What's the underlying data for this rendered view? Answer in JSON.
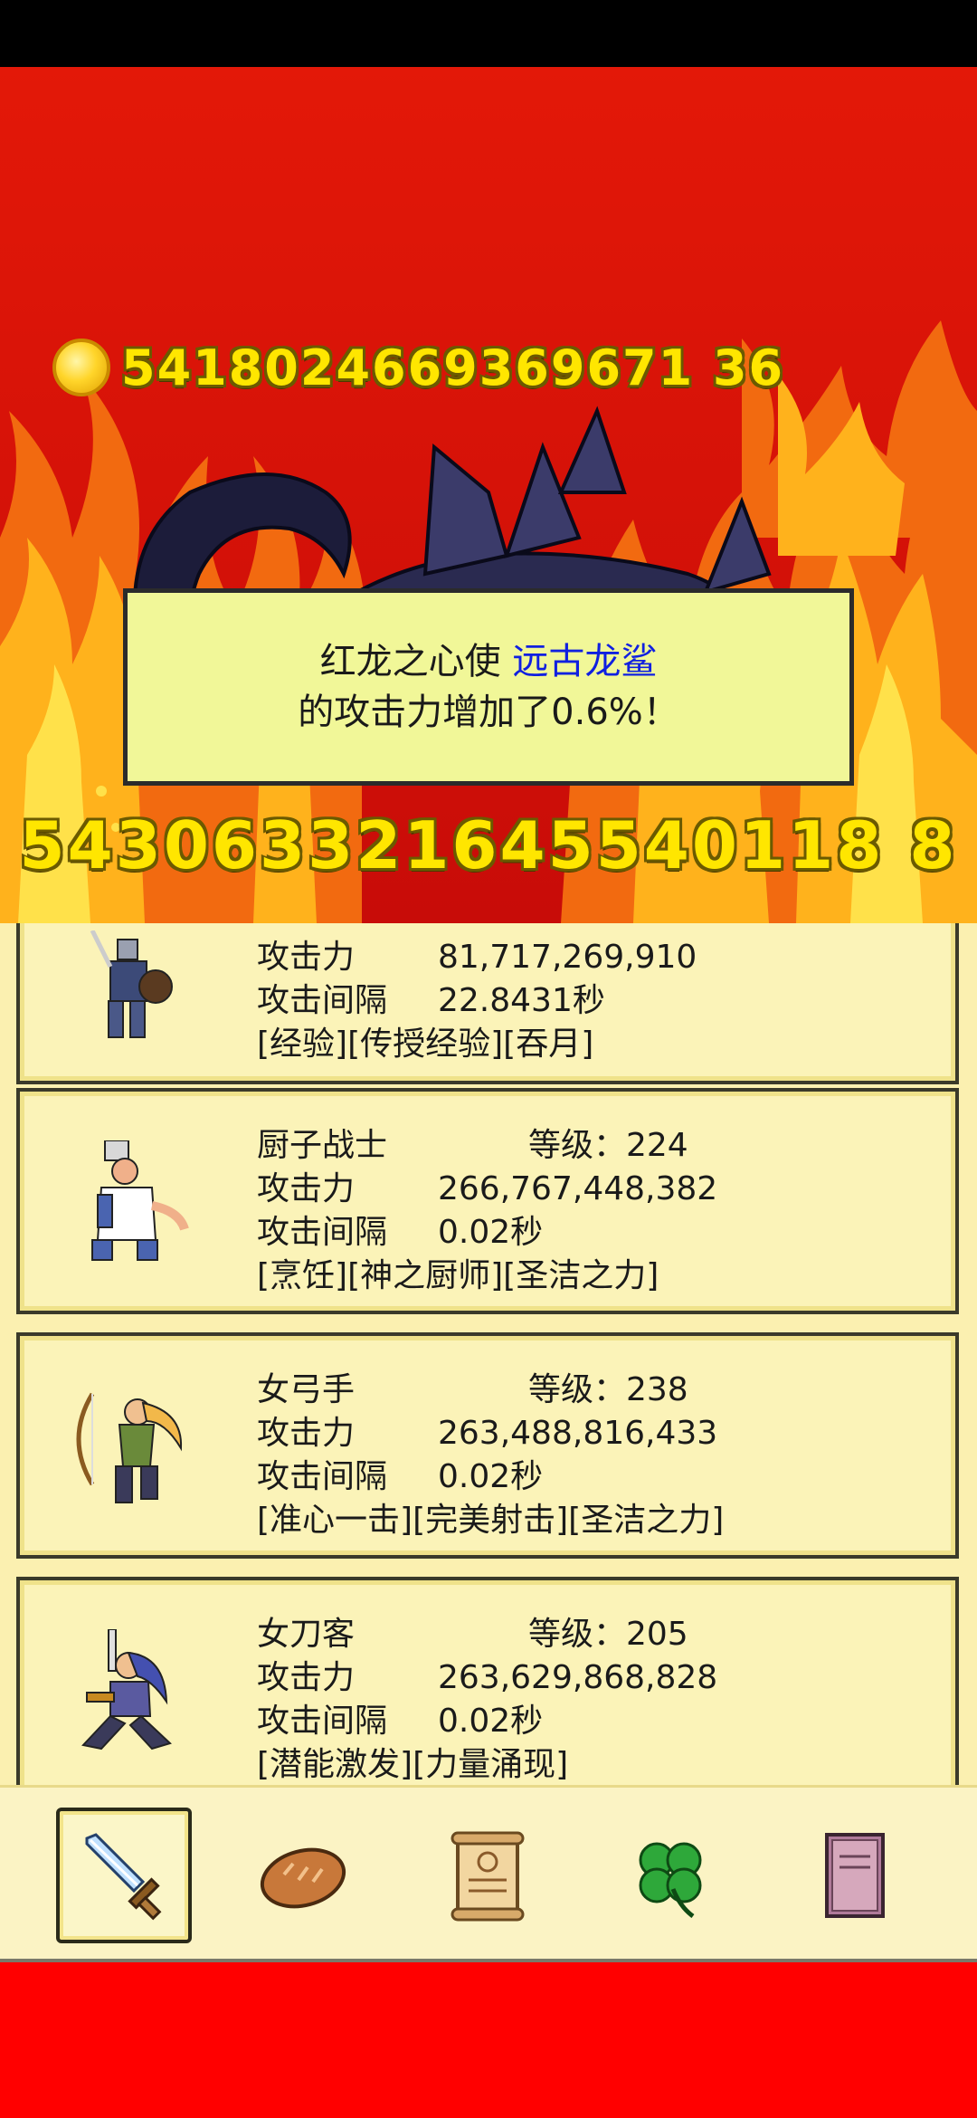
{
  "coins": "5418024669369671 36",
  "big_number": "543063321645540118 8",
  "dialog": {
    "prefix": "红龙之心使 ",
    "highlight": "远古龙鲨",
    "line2": "的攻击力增加了0.6%！"
  },
  "heroes": [
    {
      "name": "",
      "level": "",
      "atk_label": "攻击力",
      "atk": "81,717,269,910",
      "interval_label": "攻击间隔",
      "interval": "22.8431秒",
      "skills": "[经验][传授经验][吞月]"
    },
    {
      "name": "厨子战士",
      "level": "等级：224",
      "atk_label": "攻击力",
      "atk": "266,767,448,382",
      "interval_label": "攻击间隔",
      "interval": "0.02秒",
      "skills": "[烹饪][神之厨师][圣洁之力]"
    },
    {
      "name": "女弓手",
      "level": "等级：238",
      "atk_label": "攻击力",
      "atk": "263,488,816,433",
      "interval_label": "攻击间隔",
      "interval": "0.02秒",
      "skills": "[准心一击][完美射击][圣洁之力]"
    },
    {
      "name": "女刀客",
      "level": "等级：205",
      "atk_label": "攻击力",
      "atk": "263,629,868,828",
      "interval_label": "攻击间隔",
      "interval": "0.02秒",
      "skills": "[潜能激发][力量涌现]"
    }
  ],
  "nav": [
    {
      "icon": "sword-icon",
      "active": true
    },
    {
      "icon": "bread-icon",
      "active": false
    },
    {
      "icon": "scroll-icon",
      "active": false
    },
    {
      "icon": "clover-icon",
      "active": false
    },
    {
      "icon": "book-icon",
      "active": false
    }
  ],
  "colors": {
    "background_red": "#ff0000",
    "dialog_bg": "#f1f798",
    "highlight_blue": "#1020e0",
    "gold_text": "#ffe600",
    "card_bg": "#fbf3b8"
  }
}
